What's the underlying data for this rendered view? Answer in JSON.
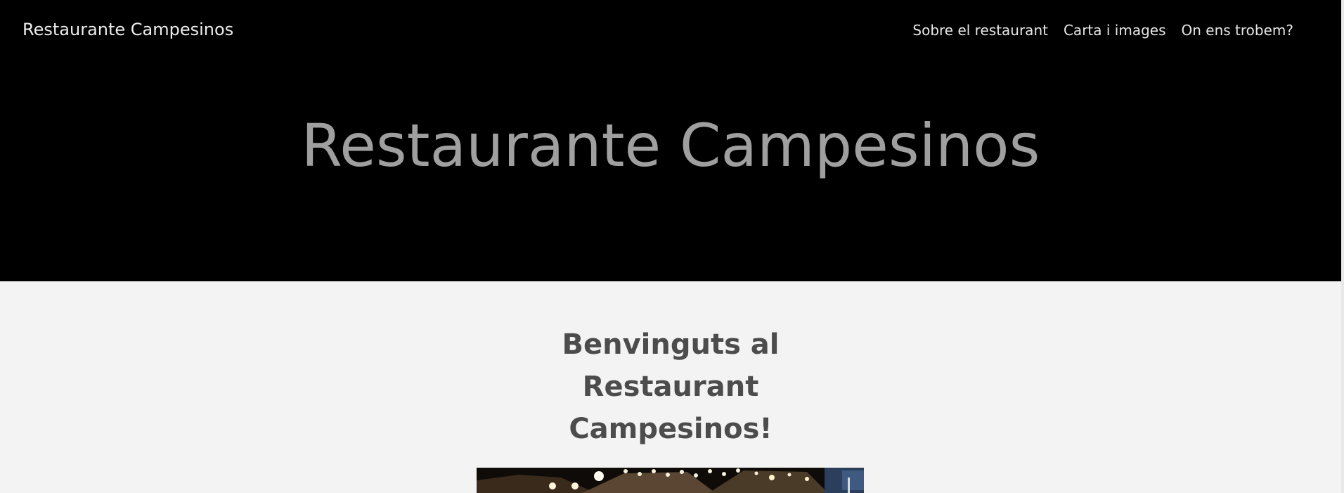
{
  "header": {
    "brand": "Restaurante Campesinos",
    "nav": [
      {
        "label": "Sobre el restaurant"
      },
      {
        "label": "Carta i images"
      },
      {
        "label": "On ens trobem?"
      }
    ]
  },
  "hero": {
    "title": "Restaurante Campesinos"
  },
  "main": {
    "welcome_line1": "Benvinguts al",
    "welcome_line2": "Restaurant",
    "welcome_line3": "Campesinos!"
  },
  "colors": {
    "header_bg": "#000000",
    "page_bg": "#f3f3f3",
    "hero_title": "#9f9f9f",
    "heading": "#4c4c4c"
  }
}
